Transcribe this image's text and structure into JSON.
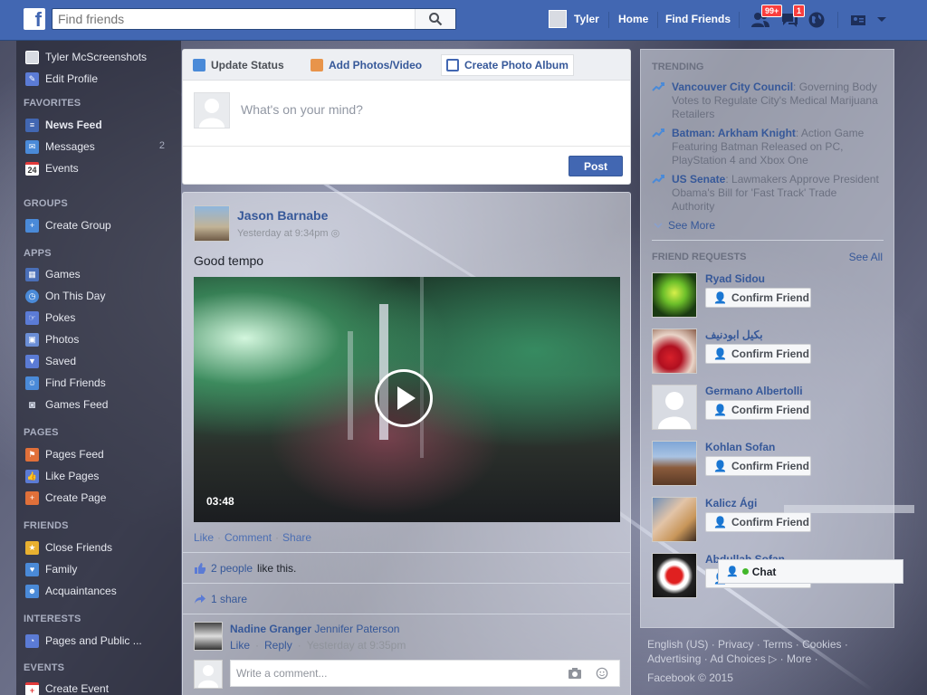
{
  "topbar": {
    "logo": "f",
    "search_placeholder": "Find friends",
    "user_name": "Tyler",
    "home": "Home",
    "find_friends": "Find Friends",
    "friend_requests_badge": "99+",
    "messages_badge": "1"
  },
  "left_nav": {
    "profile_name": "Tyler McScreenshots",
    "edit_profile": "Edit Profile",
    "favorites_heading": "FAVORITES",
    "news_feed": "News Feed",
    "messages": "Messages",
    "messages_count": "2",
    "events": "Events",
    "events_icon_day": "24",
    "groups_heading": "GROUPS",
    "create_group": "Create Group",
    "apps_heading": "APPS",
    "games": "Games",
    "on_this_day": "On This Day",
    "pokes": "Pokes",
    "photos": "Photos",
    "saved": "Saved",
    "find_friends": "Find Friends",
    "games_feed": "Games Feed",
    "pages_heading": "PAGES",
    "pages_feed": "Pages Feed",
    "like_pages": "Like Pages",
    "create_page": "Create Page",
    "friends_heading": "FRIENDS",
    "close_friends": "Close Friends",
    "family": "Family",
    "acquaintances": "Acquaintances",
    "interests_heading": "INTERESTS",
    "pages_and_public": "Pages and Public ...",
    "events_heading": "EVENTS",
    "create_event": "Create Event"
  },
  "composer": {
    "tab_update_status": "Update Status",
    "tab_add_photos": "Add Photos/Video",
    "tab_create_album": "Create Photo Album",
    "placeholder": "What's on your mind?",
    "post_button": "Post"
  },
  "story": {
    "author": "Jason Barnabe",
    "time": "Yesterday at 9:34pm",
    "text": "Good tempo",
    "video_duration": "03:48",
    "action_like": "Like",
    "action_comment": "Comment",
    "action_share": "Share",
    "likes_link": "2 people",
    "likes_suffix": "like this.",
    "shares": "1 share",
    "comment_author": "Nadine Granger",
    "comment_text": "Jennifer Paterson",
    "comment_like": "Like",
    "comment_reply": "Reply",
    "comment_time": "Yesterday at 9:35pm",
    "write_comment_placeholder": "Write a comment..."
  },
  "trending": {
    "heading": "TRENDING",
    "items": [
      {
        "title": "Vancouver City Council",
        "desc": ": Governing Body Votes to Regulate City's Medical Marijuana Retailers"
      },
      {
        "title": "Batman: Arkham Knight",
        "desc": ": Action Game Featuring Batman Released on PC, PlayStation 4 and Xbox One"
      },
      {
        "title": "US Senate",
        "desc": ": Lawmakers Approve President Obama's Bill for 'Fast Track' Trade Authority"
      }
    ],
    "see_more": "See More"
  },
  "friend_requests": {
    "heading": "FRIEND REQUESTS",
    "see_all": "See All",
    "confirm_label": "Confirm Friend",
    "people": [
      {
        "name": "Ryad Sidou"
      },
      {
        "name": "بكيل ابودنيف"
      },
      {
        "name": "Germano Albertolli"
      },
      {
        "name": "Kohlan Sofan"
      },
      {
        "name": "Kalicz Ági"
      },
      {
        "name": "Abdullah Sofan"
      }
    ]
  },
  "footer": {
    "line1": "English (US) · Privacy · Terms · Cookies ·",
    "line2": "Advertising · Ad Choices ▷ · More ·",
    "line3": "Facebook © 2015"
  },
  "chat": {
    "label": "Chat"
  },
  "colors": {
    "brand_blue": "#4267b2",
    "link_blue": "#365899",
    "badge_red": "#fa3e3e",
    "online_green": "#42b72a"
  }
}
